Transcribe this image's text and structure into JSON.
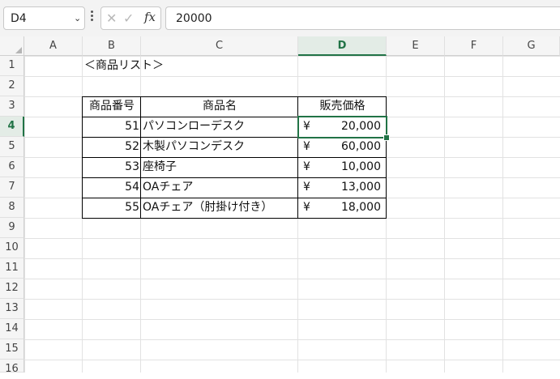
{
  "formula_bar": {
    "name_box": "D4",
    "cancel_symbol": "✕",
    "enter_symbol": "✓",
    "fx_label": "fx",
    "formula": "20000"
  },
  "columns": [
    "A",
    "B",
    "C",
    "D",
    "E",
    "F",
    "G"
  ],
  "active_column": "D",
  "rows": [
    "1",
    "2",
    "3",
    "4",
    "5",
    "6",
    "7",
    "8",
    "9",
    "10",
    "11",
    "12",
    "13",
    "14",
    "15",
    "16"
  ],
  "active_row": "4",
  "sheet": {
    "title": "＜商品リスト＞",
    "headers": {
      "code": "商品番号",
      "name": "商品名",
      "price": "販売価格"
    },
    "items": [
      {
        "code": "51",
        "name": "パソコンローデスク",
        "yen": "¥",
        "price": "20,000"
      },
      {
        "code": "52",
        "name": "木製パソコンデスク",
        "yen": "¥",
        "price": "60,000"
      },
      {
        "code": "53",
        "name": "座椅子",
        "yen": "¥",
        "price": "10,000"
      },
      {
        "code": "54",
        "name": "OAチェア",
        "yen": "¥",
        "price": "13,000"
      },
      {
        "code": "55",
        "name": "OAチェア（肘掛け付き）",
        "yen": "¥",
        "price": "18,000"
      }
    ]
  }
}
